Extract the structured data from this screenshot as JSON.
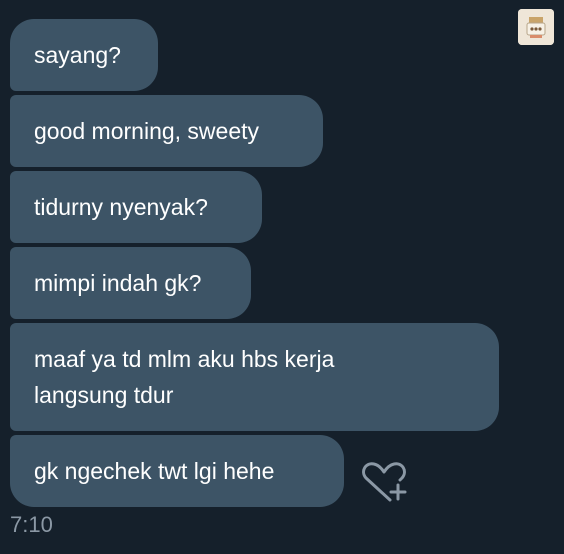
{
  "messages": [
    {
      "text": "sayang?"
    },
    {
      "text": "good morning, sweety"
    },
    {
      "text": "tidurny nyenyak?"
    },
    {
      "text": "mimpi indah gk?"
    },
    {
      "text_line1": "maaf ya td mlm aku hbs kerja",
      "text_line2": "langsung tdur"
    },
    {
      "text": "gk ngechek twt lgi hehe"
    }
  ],
  "timestamp": "7:10",
  "react_icon": "heart-plus-icon",
  "colors": {
    "background": "#15202b",
    "bubble": "#3d5466",
    "text": "#ffffff",
    "muted": "#8b98a5"
  }
}
